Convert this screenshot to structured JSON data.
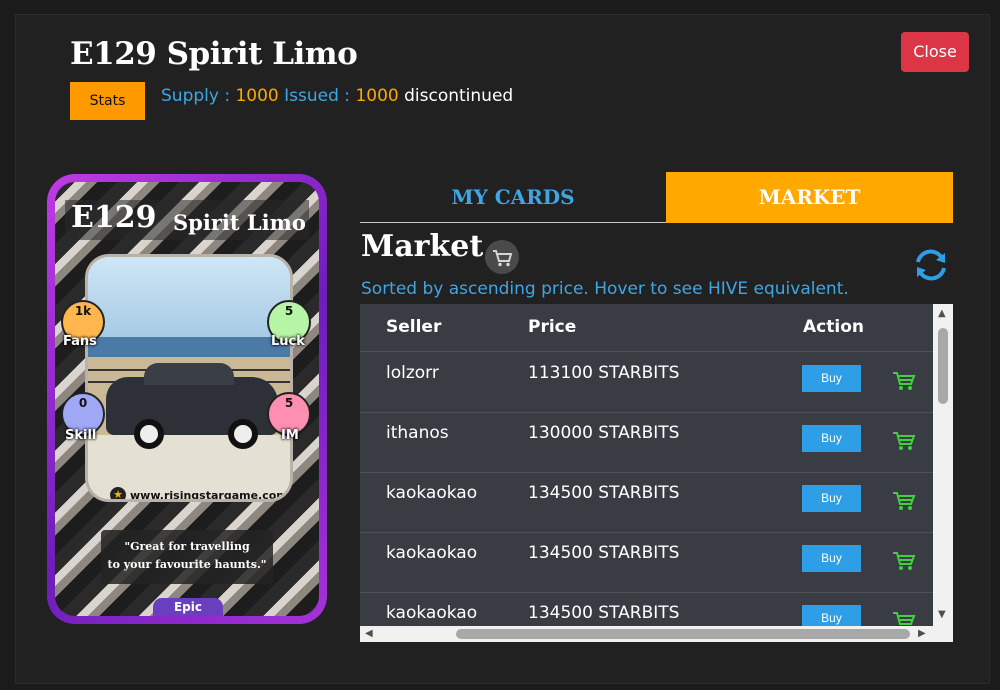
{
  "header": {
    "title": "E129 Spirit Limo",
    "close_label": "Close",
    "stats_label": "Stats",
    "supply_label": "Supply :",
    "supply_value": "1000",
    "issued_label": "Issued :",
    "issued_value": "1000",
    "status": "discontinued"
  },
  "card": {
    "code": "E129",
    "name": "Spirit Limo",
    "stats": {
      "fans": {
        "value": "1k",
        "label": "Fans",
        "color": "#ffb74d"
      },
      "luck": {
        "value": "5",
        "label": "Luck",
        "color": "#b7f5a6"
      },
      "skill": {
        "value": "0",
        "label": "Skill",
        "color": "#9fa8f5"
      },
      "im": {
        "value": "5",
        "label": "IM",
        "color": "#ff8fb0"
      }
    },
    "website": "www.risingstargame.com",
    "quote_line1": "\"Great for travelling",
    "quote_line2": "to your favourite haunts.\"",
    "rarity": "Epic"
  },
  "tabs": {
    "my_cards": "MY CARDS",
    "market": "MARKET"
  },
  "market": {
    "heading": "Market",
    "sorted_note": "Sorted by ascending price. Hover to see HIVE equivalent.",
    "columns": {
      "seller": "Seller",
      "price": "Price",
      "action": "Action"
    },
    "buy_label": "Buy",
    "rows": [
      {
        "seller": "lolzorr",
        "price": "113100 STARBITS"
      },
      {
        "seller": "ithanos",
        "price": "130000 STARBITS"
      },
      {
        "seller": "kaokaokao",
        "price": "134500 STARBITS"
      },
      {
        "seller": "kaokaokao",
        "price": "134500 STARBITS"
      },
      {
        "seller": "kaokaokao",
        "price": "134500 STARBITS"
      }
    ]
  },
  "colors": {
    "accent_orange": "#ffa800",
    "accent_blue": "#3fa6e6",
    "close_red": "#dc3545",
    "cart_green": "#3fcf3f"
  }
}
